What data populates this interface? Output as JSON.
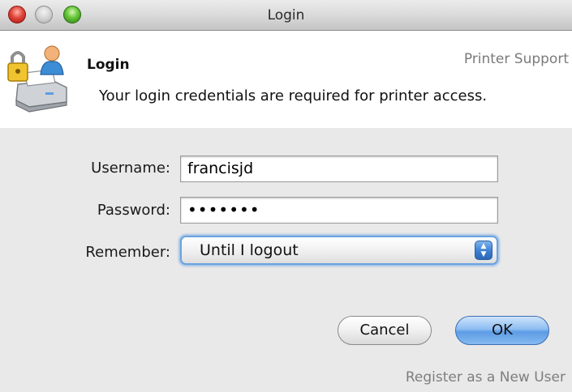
{
  "window": {
    "title": "Login"
  },
  "header": {
    "title": "Login",
    "brand": "Printer Support",
    "description": "Your login credentials are required for printer access."
  },
  "form": {
    "username": {
      "label": "Username:",
      "value": "francisjd"
    },
    "password": {
      "label": "Password:",
      "value": "•••••••"
    },
    "remember": {
      "label": "Remember:",
      "selected": "Until I logout"
    }
  },
  "buttons": {
    "cancel": "Cancel",
    "ok": "OK"
  },
  "links": {
    "register": "Register as a New User"
  },
  "icons": {
    "window_controls": [
      "close-icon",
      "minimize-icon",
      "zoom-icon"
    ],
    "header": "printer-lock-user-icon",
    "select": "up-down-arrows-icon"
  },
  "colors": {
    "accent": "#5d9ce6",
    "focus_ring": "#6aa2e0",
    "close": "#e0443a",
    "minimize": "#cfcfcf",
    "zoom": "#64c437"
  }
}
